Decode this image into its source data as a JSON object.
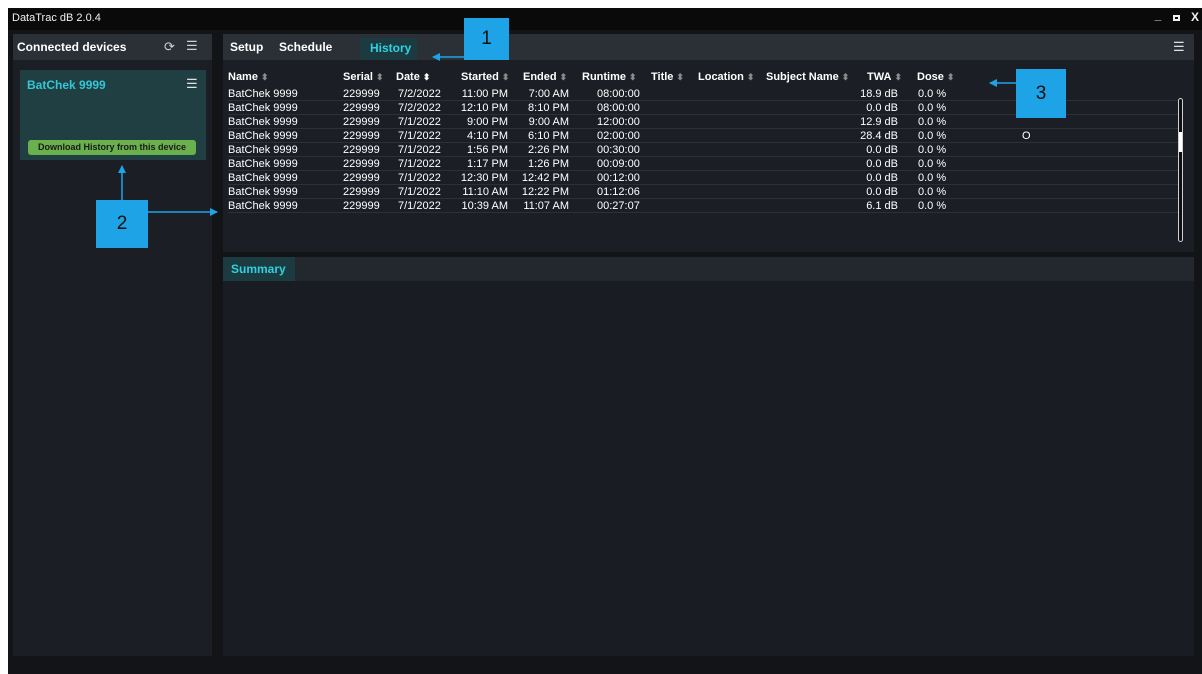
{
  "window": {
    "title": "DataTrac dB 2.0.4",
    "minimize": "_",
    "close": "X"
  },
  "left_panel": {
    "header": "Connected devices",
    "refresh_icon": "⟳",
    "menu_icon": "☰",
    "device": {
      "name": "BatChek 9999",
      "menu_icon": "☰",
      "download_label": "Download History from this device"
    }
  },
  "tabs": {
    "setup": "Setup",
    "schedule": "Schedule",
    "history": "History",
    "menu_icon": "☰"
  },
  "table": {
    "columns": {
      "name": "Name",
      "serial": "Serial",
      "date": "Date",
      "started": "Started",
      "ended": "Ended",
      "runtime": "Runtime",
      "title": "Title",
      "location": "Location",
      "subject": "Subject Name",
      "twa": "TWA",
      "dose": "Dose"
    },
    "sort_glyph": "⬍",
    "sort_active_glyph": "⬍",
    "rows": [
      {
        "name": "BatChek 9999",
        "serial": "229999",
        "date": "7/2/2022",
        "started": "11:00 PM",
        "ended": "7:00 AM",
        "runtime": "08:00:00",
        "twa": "18.9 dB",
        "dose": "0.0 %",
        "extra": ""
      },
      {
        "name": "BatChek 9999",
        "serial": "229999",
        "date": "7/2/2022",
        "started": "12:10 PM",
        "ended": "8:10 PM",
        "runtime": "08:00:00",
        "twa": "0.0 dB",
        "dose": "0.0 %",
        "extra": ""
      },
      {
        "name": "BatChek 9999",
        "serial": "229999",
        "date": "7/1/2022",
        "started": "9:00 PM",
        "ended": "9:00 AM",
        "runtime": "12:00:00",
        "twa": "12.9 dB",
        "dose": "0.0 %",
        "extra": ""
      },
      {
        "name": "BatChek 9999",
        "serial": "229999",
        "date": "7/1/2022",
        "started": "4:10 PM",
        "ended": "6:10 PM",
        "runtime": "02:00:00",
        "twa": "28.4 dB",
        "dose": "0.0 %",
        "extra": "O"
      },
      {
        "name": "BatChek 9999",
        "serial": "229999",
        "date": "7/1/2022",
        "started": "1:56 PM",
        "ended": "2:26 PM",
        "runtime": "00:30:00",
        "twa": "0.0 dB",
        "dose": "0.0 %",
        "extra": ""
      },
      {
        "name": "BatChek 9999",
        "serial": "229999",
        "date": "7/1/2022",
        "started": "1:17 PM",
        "ended": "1:26 PM",
        "runtime": "00:09:00",
        "twa": "0.0 dB",
        "dose": "0.0 %",
        "extra": ""
      },
      {
        "name": "BatChek 9999",
        "serial": "229999",
        "date": "7/1/2022",
        "started": "12:30 PM",
        "ended": "12:42 PM",
        "runtime": "00:12:00",
        "twa": "0.0 dB",
        "dose": "0.0 %",
        "extra": ""
      },
      {
        "name": "BatChek 9999",
        "serial": "229999",
        "date": "7/1/2022",
        "started": "11:10 AM",
        "ended": "12:22 PM",
        "runtime": "01:12:06",
        "twa": "0.0 dB",
        "dose": "0.0 %",
        "extra": ""
      },
      {
        "name": "BatChek 9999",
        "serial": "229999",
        "date": "7/1/2022",
        "started": "10:39 AM",
        "ended": "11:07 AM",
        "runtime": "00:27:07",
        "twa": "6.1 dB",
        "dose": "0.0 %",
        "extra": ""
      }
    ]
  },
  "summary": {
    "tab": "Summary"
  },
  "callouts": {
    "one": "1",
    "two": "2",
    "three": "3"
  },
  "colors": {
    "accent": "#2fd0e0",
    "callout": "#1ea4e6",
    "download_button": "#6ab04c"
  }
}
